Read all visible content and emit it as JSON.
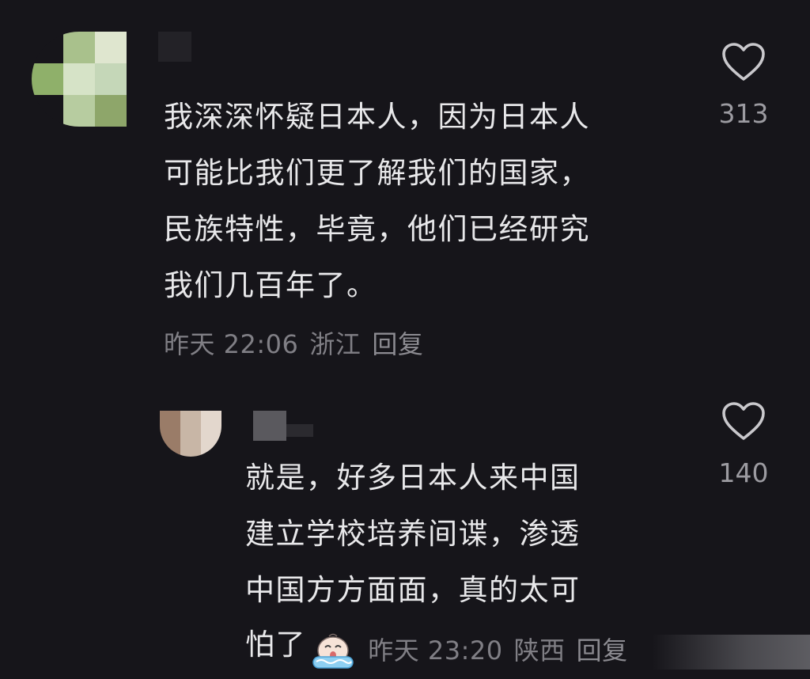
{
  "comment": {
    "text": "我深深怀疑日本人，因为日本人\n可能比我们更了解我们的国家，\n民族特性，毕竟，他们已经研究\n我们几百年了。",
    "time": "昨天 22:06",
    "location": "浙江",
    "reply_label": "回复",
    "likes": "313",
    "avatar_colors": [
      "#16151a",
      "#a9c18c",
      "#dfe6cf",
      "#8fb06a",
      "#d6e3c7",
      "#c5d7b8",
      "#16151a",
      "#b7cca0",
      "#8ea66a"
    ]
  },
  "reply": {
    "text": "就是，好多日本人来中国\n建立学校培养间谍，渗透\n中国方方面面，真的太可",
    "last_line": "怕了",
    "emoji": "crying-face-emoji",
    "time": "昨天 23:20",
    "location": "陕西",
    "reply_label": "回复",
    "likes": "140",
    "avatar_colors": [
      "#9a7c68",
      "#c8b6a6",
      "#e3d7cd"
    ]
  },
  "colors": {
    "background": "#16151a",
    "text": "#e8e8ea",
    "meta": "#807f85"
  }
}
